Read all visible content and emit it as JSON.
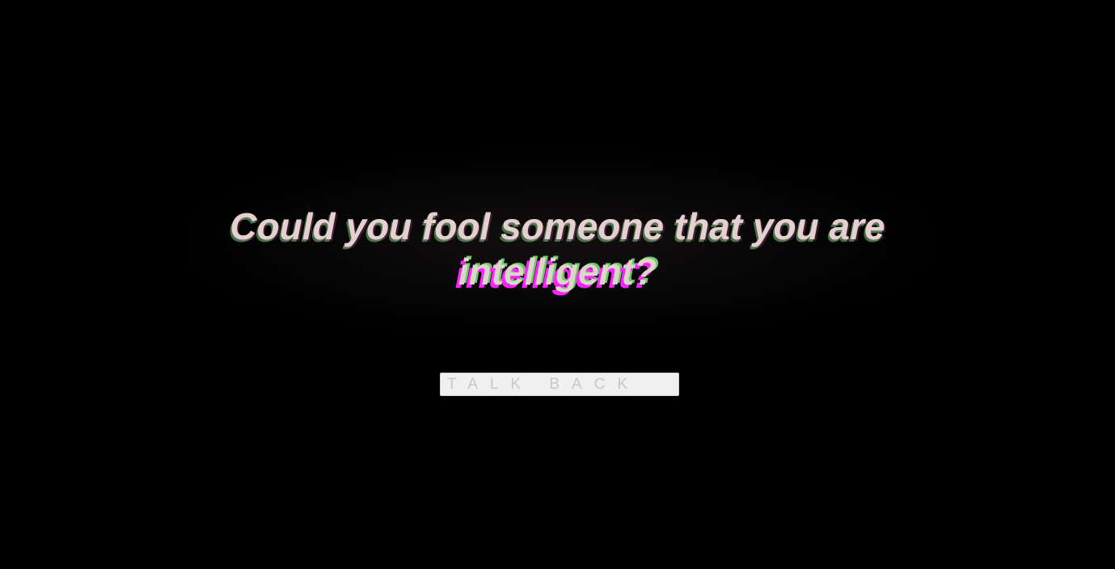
{
  "headline": {
    "line1": "Could you fool someone that you are",
    "line2": "intelligent?"
  },
  "cta": {
    "label": "TALK BACK"
  },
  "colors": {
    "background": "#000000",
    "text": "#e6cfd1",
    "glitch_magenta": "#ff22ff",
    "glitch_green": "#78dc78",
    "button_bg": "#f1f0f0",
    "button_text": "#cbc5c6"
  }
}
